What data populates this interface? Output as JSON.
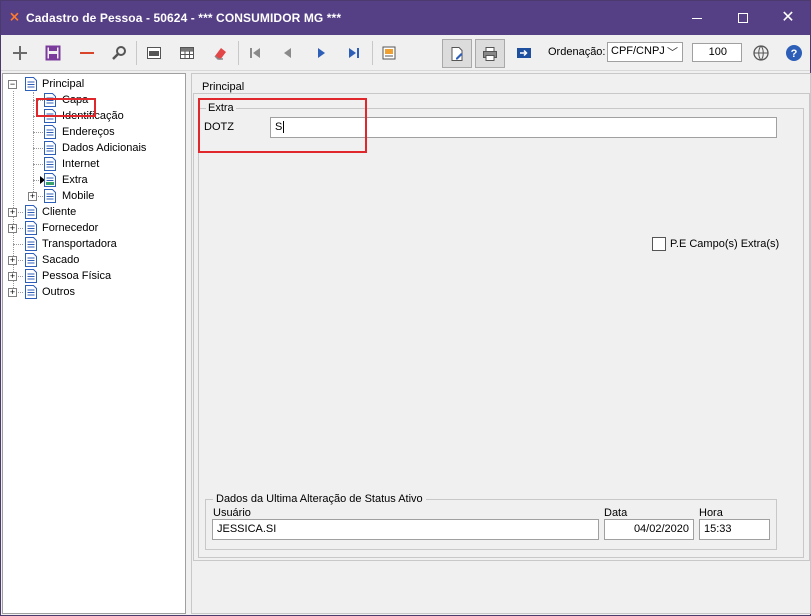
{
  "window": {
    "title": "Cadastro de Pessoa - 50624 - *** CONSUMIDOR MG ***",
    "app_icon": "pin-icon"
  },
  "toolbar": {
    "buttons": [
      {
        "name": "add-icon"
      },
      {
        "name": "save-icon"
      },
      {
        "name": "remove-icon"
      },
      {
        "name": "search-icon"
      },
      {
        "name": "txt-export-icon"
      },
      {
        "name": "grid-icon"
      },
      {
        "name": "eraser-icon"
      },
      {
        "name": "first-record-icon"
      },
      {
        "name": "previous-record-icon"
      },
      {
        "name": "next-record-icon"
      },
      {
        "name": "last-record-icon"
      },
      {
        "name": "report-icon"
      },
      {
        "name": "edit-document-icon"
      },
      {
        "name": "printer-icon"
      },
      {
        "name": "export-arrow-icon"
      },
      {
        "name": "globe-settings-icon"
      },
      {
        "name": "help-icon"
      }
    ],
    "ordenacao_label": "Ordenação:",
    "ordenacao_value": "CPF/CNPJ",
    "zoom_value": "100"
  },
  "tree": {
    "root": "Principal",
    "children": [
      "Capa",
      "Identificação",
      "Endereços",
      "Dados Adicionais",
      "Internet",
      "Extra",
      "Mobile"
    ],
    "others": [
      "Cliente",
      "Fornecedor",
      "Transportadora",
      "Sacado",
      "Pessoa Física",
      "Outros"
    ]
  },
  "panel": {
    "principal_label": "Principal",
    "extra_label": "Extra",
    "dotz_label": "DOTZ",
    "dotz_value": "S",
    "pe_label": "P.E Campo(s) Extra(s)",
    "status_title": "Dados da Ultima Alteração de Status Ativo",
    "usuario_label": "Usuário",
    "usuario_value": "JESSICA.SI",
    "data_label": "Data",
    "data_value": "04/02/2020",
    "hora_label": "Hora",
    "hora_value": "15:33"
  }
}
